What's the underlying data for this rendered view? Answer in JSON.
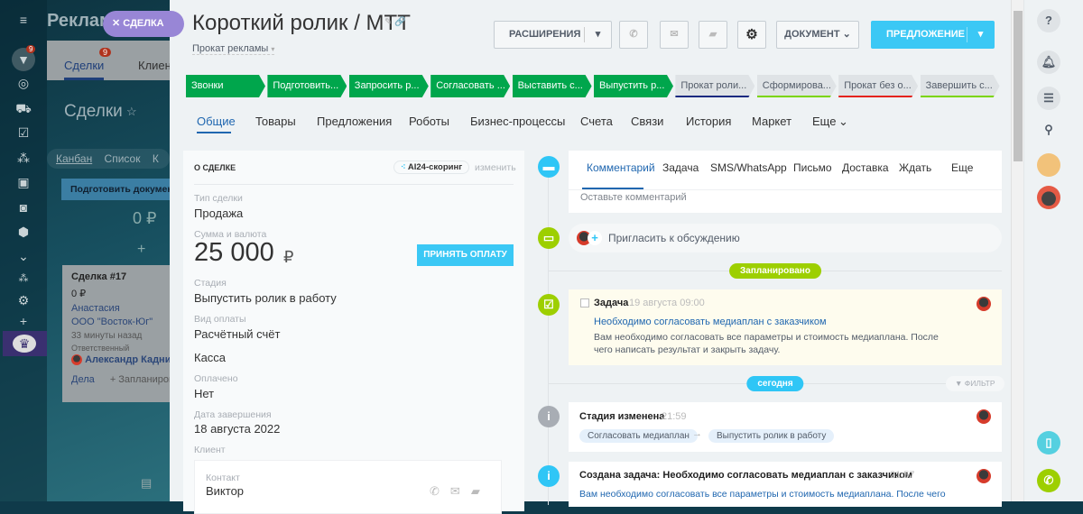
{
  "background_page": {
    "title": "Реклама",
    "tabs": [
      {
        "label": "Сделки",
        "badge": "9"
      },
      {
        "label": "Клиенты"
      }
    ],
    "heading": "Сделки",
    "views": [
      "Канбан",
      "Список",
      "К"
    ],
    "column": {
      "name": "Подготовить документ",
      "sum": "0 ₽"
    },
    "card": {
      "title": "Сделка #17",
      "sum": "0 ₽",
      "contact": "Анастасия",
      "company": "ООО \"Восток-Юг\"",
      "time": "33 минуты назад",
      "responsible_label": "Ответственный",
      "responsible": "Александр Кадников",
      "activities": "Дела",
      "plan": "+ Запланировать"
    },
    "nav_badge": "9"
  },
  "slider_label": "СДЕЛКА",
  "header": {
    "title": "Короткий ролик / МТТ",
    "category": "Прокат рекламы",
    "extensions": "РАСШИРЕНИЯ",
    "document": "ДОКУМЕНТ",
    "proposal": "ПРЕДЛОЖЕНИЕ"
  },
  "stages": [
    {
      "label": "Звонки",
      "done": true
    },
    {
      "label": "Подготовить...",
      "done": true
    },
    {
      "label": "Запросить р...",
      "done": true
    },
    {
      "label": "Согласовать ...",
      "done": true
    },
    {
      "label": "Выставить с...",
      "done": true
    },
    {
      "label": "Выпустить р...",
      "done": true
    },
    {
      "label": "Прокат роли...",
      "done": false,
      "color": "#1b2a80"
    },
    {
      "label": "Сформирова...",
      "done": false,
      "color": "#7bd500"
    },
    {
      "label": "Прокат без о...",
      "done": false,
      "color": "#e4231d"
    },
    {
      "label": "Завершить с...",
      "done": false,
      "color": "#7bd500"
    }
  ],
  "tabs": [
    "Общие",
    "Товары",
    "Предложения",
    "Роботы",
    "Бизнес-процессы",
    "Счета",
    "Связи",
    "История",
    "Маркет",
    "Еще"
  ],
  "about": {
    "title": "О СДЕЛКЕ",
    "scoring": "AI24-скоринг",
    "edit": "изменить",
    "fields": {
      "type_label": "Тип сделки",
      "type": "Продажа",
      "sum_label": "Сумма и валюта",
      "sum": "25 000",
      "currency": "₽",
      "pay_button": "ПРИНЯТЬ ОПЛАТУ",
      "stage_label": "Стадия",
      "stage": "Выпустить ролик в работу",
      "pay_type_label": "Вид оплаты",
      "pay_type": "Расчётный счёт",
      "cash": "Касса",
      "paid_label": "Оплачено",
      "paid": "Нет",
      "close_label": "Дата завершения",
      "close": "18 августа 2022",
      "client_label": "Клиент",
      "contact_label": "Контакт",
      "contact": "Виктор"
    }
  },
  "timeline": {
    "tabs": [
      "Комментарий",
      "Задача",
      "SMS/WhatsApp",
      "Письмо",
      "Доставка",
      "Ждать",
      "Еще"
    ],
    "comment_placeholder": "Оставьте комментарий",
    "invite": "Пригласить к обсуждению",
    "planned": "Запланировано",
    "task": {
      "type": "Задача",
      "date": "19 августа 09:00",
      "title": "Необходимо согласовать медиаплан с заказчиком",
      "text": "Вам необходимо согласовать все параметры и стоимость медиаплана. После чего написать результат и закрыть задачу."
    },
    "today": "сегодня",
    "filter": "ФИЛЬТР",
    "stage_change": {
      "title": "Стадия изменена",
      "time": "21:59",
      "from": "Согласовать медиаплан",
      "to": "Выпустить ролик в работу"
    },
    "created": {
      "title": "Создана задача: Необходимо согласовать медиаплан с заказчиком",
      "time": "21:57",
      "text": "Вам необходимо согласовать все параметры и стоимость медиаплана. После чего"
    }
  }
}
